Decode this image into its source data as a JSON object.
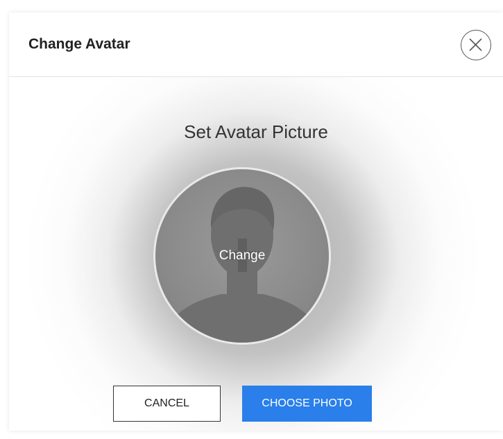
{
  "dialog": {
    "title": "Change Avatar",
    "close_icon": "close-circle-icon"
  },
  "body": {
    "heading": "Set Avatar Picture",
    "avatar": {
      "icon": "default-user-silhouette-icon",
      "overlay_label": "Change",
      "overlay_icon": "plus-icon"
    }
  },
  "actions": {
    "cancel_label": "CANCEL",
    "choose_label": "CHOOSE PHOTO"
  },
  "colors": {
    "primary": "#2a7fea",
    "avatar_gray": "#8a8a8a",
    "text_dark": "#222222"
  }
}
